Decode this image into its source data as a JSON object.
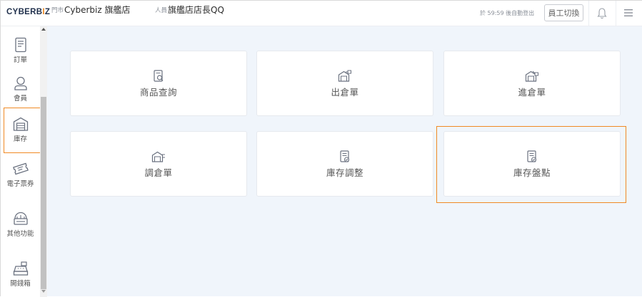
{
  "header": {
    "logo_main": "CYBERB",
    "logo_accent": "I",
    "logo_end": "Z",
    "store_label": "門市",
    "store_name": "Cyberbiz 旗艦店",
    "staff_label": "人員",
    "staff_name": "旗艦店店長QQ",
    "logout_text": "於 59:59 後自動登出",
    "switch_label": "員工切換",
    "bell_icon": "bell-icon",
    "menu_icon": "hamburger-menu-icon"
  },
  "sidebar": {
    "items": [
      {
        "label": "訂單",
        "icon": "order-document-icon"
      },
      {
        "label": "會員",
        "icon": "member-person-icon"
      },
      {
        "label": "庫存",
        "icon": "warehouse-icon",
        "active": true
      },
      {
        "label": "電子票券",
        "icon": "ticket-icon"
      },
      {
        "label": "其他功能",
        "icon": "other-functions-icon"
      },
      {
        "label": "開錢箱",
        "icon": "cash-register-icon"
      }
    ]
  },
  "main": {
    "cards": [
      {
        "label": "商品查詢",
        "icon": "product-search-icon"
      },
      {
        "label": "出倉單",
        "icon": "warehouse-out-icon"
      },
      {
        "label": "進倉單",
        "icon": "warehouse-in-icon"
      },
      {
        "label": "調倉單",
        "icon": "warehouse-transfer-icon"
      },
      {
        "label": "庫存調整",
        "icon": "inventory-adjust-icon"
      },
      {
        "label": "庫存盤點",
        "icon": "inventory-count-icon",
        "highlighted": true
      }
    ]
  },
  "colors": {
    "accent": "#f08a24",
    "brand_dark": "#1f2f4b",
    "background": "#f0f5fb",
    "icon": "#6b7280"
  }
}
